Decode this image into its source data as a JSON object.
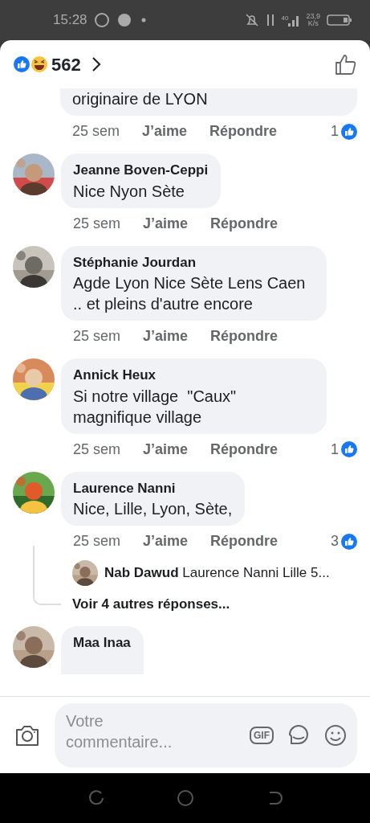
{
  "status_bar": {
    "time": "15:28",
    "network": "40",
    "speed": "23,9",
    "speed_unit": "K/s"
  },
  "header": {
    "reaction_count": "562"
  },
  "comments": [
    {
      "text": "originaire de LYON",
      "time": "25 sem",
      "like_label": "J’aime",
      "reply_label": "Répondre",
      "likes": "1"
    },
    {
      "author": "Jeanne Boven-Ceppi",
      "text": "Nice Nyon Sète",
      "time": "25 sem",
      "like_label": "J’aime",
      "reply_label": "Répondre"
    },
    {
      "author": "Stéphanie Jourdan",
      "text": "Agde Lyon Nice Sète Lens Caen .. et pleins d'autre encore",
      "time": "25 sem",
      "like_label": "J’aime",
      "reply_label": "Répondre"
    },
    {
      "author": "Annick Heux",
      "text": "Si notre village  \"Caux\" magnifique village",
      "time": "25 sem",
      "like_label": "J’aime",
      "reply_label": "Répondre",
      "likes": "1"
    },
    {
      "author": "Laurence Nanni",
      "text": "Nice, Lille, Lyon, Sète,",
      "time": "25 sem",
      "like_label": "J’aime",
      "reply_label": "Répondre",
      "likes": "3",
      "replies": [
        {
          "author": "Nab Dawud",
          "text": "Laurence Nanni Lille 5..."
        }
      ],
      "more_replies": "Voir 4 autres réponses..."
    },
    {
      "author": "Maa Inaa"
    }
  ],
  "composer": {
    "placeholder": "Votre commentaire...",
    "gif_label": "GIF"
  }
}
